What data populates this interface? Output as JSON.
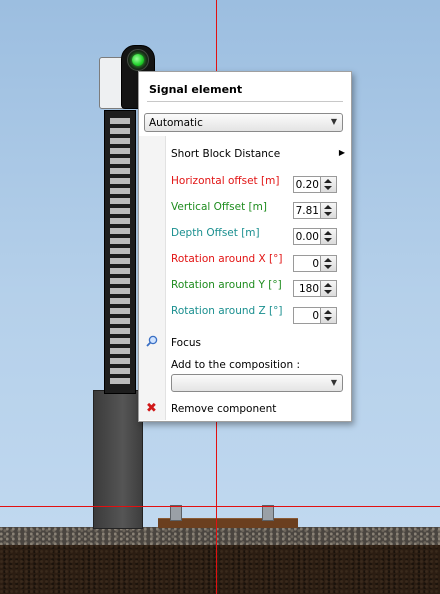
{
  "panel": {
    "title": "Signal element",
    "mode_select": {
      "value": "Automatic"
    },
    "menu": {
      "short_block_distance": "Short Block Distance"
    },
    "properties": [
      {
        "label": "Horizontal offset  [m]",
        "value": "0.20",
        "color": "#e21414"
      },
      {
        "label": "Vertical Offset  [m]",
        "value": "7.81",
        "color": "#1e8c1e"
      },
      {
        "label": "Depth Offset  [m]",
        "value": "0.00",
        "color": "#1a8f8f"
      },
      {
        "label": "Rotation around X  [°]",
        "value": "0",
        "color": "#e21414"
      },
      {
        "label": "Rotation around Y  [°]",
        "value": "180",
        "color": "#1e8c1e"
      },
      {
        "label": "Rotation around Z  [°]",
        "value": "0",
        "color": "#1a8f8f"
      }
    ],
    "focus_label": "Focus",
    "compose_label": "Add to the composition :",
    "compose_select": {
      "value": ""
    },
    "remove_label": "Remove component"
  },
  "icons": {
    "submenu": "chevron-right-icon",
    "spin": "spin-arrows-icon",
    "focus": "magnifier-icon",
    "remove": "red-x-icon"
  },
  "colors": {
    "guide_lines": "#e21010",
    "signal_lamp": "#20d02a"
  }
}
